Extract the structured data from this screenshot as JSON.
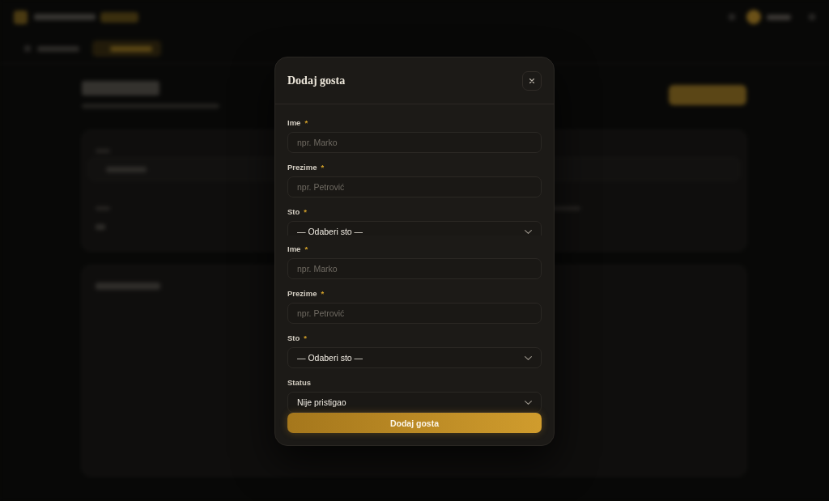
{
  "modal": {
    "title": "Dodaj gosta",
    "sections": [
      {
        "cut_off": true,
        "fields": [
          {
            "kind": "text",
            "label": "Ime",
            "required_mark": "*",
            "placeholder": "npr. Marko"
          },
          {
            "kind": "text",
            "label": "Prezime",
            "required_mark": "*",
            "placeholder": "npr. Petrović"
          },
          {
            "kind": "select",
            "label": "Sto",
            "required_mark": "*",
            "value": "— Odaberi sto —"
          }
        ]
      },
      {
        "cut_off": false,
        "fields": [
          {
            "kind": "text",
            "label": "Ime",
            "required_mark": "*",
            "placeholder": "npr. Marko"
          },
          {
            "kind": "text",
            "label": "Prezime",
            "required_mark": "*",
            "placeholder": "npr. Petrović"
          },
          {
            "kind": "select",
            "label": "Sto",
            "required_mark": "*",
            "value": "— Odaberi sto —"
          },
          {
            "kind": "select",
            "label": "Status",
            "value": "Nije pristigao"
          }
        ]
      }
    ],
    "submit": "Dodaj gosta"
  }
}
